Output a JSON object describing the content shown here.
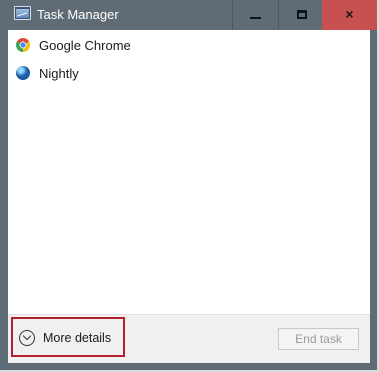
{
  "window": {
    "title": "Task Manager",
    "icon": "task-manager-icon",
    "controls": {
      "minimize_icon": "minimize-icon",
      "maximize_icon": "maximize-icon",
      "close_symbol": "×",
      "close_color": "#c75050"
    }
  },
  "processes": [
    {
      "label": "Google Chrome",
      "icon": "chrome-icon"
    },
    {
      "label": "Nightly",
      "icon": "nightly-icon"
    }
  ],
  "footer": {
    "more_details_label": "More details",
    "more_details_icon": "chevron-down-circle-icon",
    "highlight_color": "#b21f2d",
    "end_task_label": "End task",
    "end_task_enabled": false
  }
}
